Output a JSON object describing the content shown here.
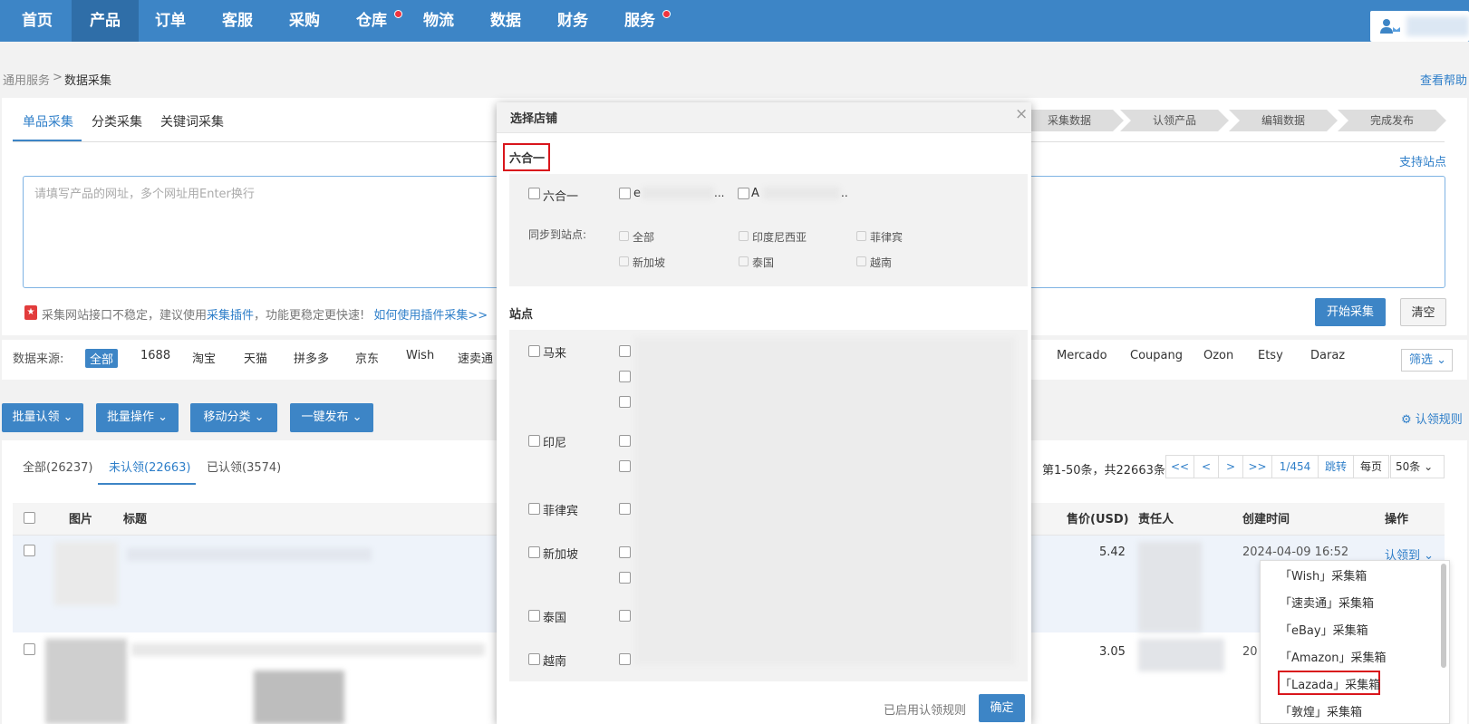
{
  "nav": {
    "items": [
      "首页",
      "产品",
      "订单",
      "客服",
      "采购",
      "仓库",
      "物流",
      "数据",
      "财务",
      "服务"
    ],
    "active_index": 1
  },
  "breadcrumb": {
    "parent": "通用服务",
    "sep": ">",
    "current": "数据采集"
  },
  "help_link": "查看帮助",
  "collect_tabs": [
    "单品采集",
    "分类采集",
    "关键词采集"
  ],
  "steps": [
    "采集数据",
    "认领产品",
    "编辑数据",
    "完成发布"
  ],
  "supported_sites": "支持站点",
  "url_input": {
    "placeholder": "请填写产品的网址，多个网址用Enter换行"
  },
  "notice": {
    "text1": "采集网站接口不稳定，建议使用",
    "plugin": "采集插件",
    "text2": "，功能更稳定更快速!",
    "howto": "如何使用插件采集>>"
  },
  "start_btn": "开始采集",
  "clear_btn": "清空",
  "sources": {
    "label": "数据来源:",
    "items": [
      "全部",
      "1688",
      "淘宝",
      "天猫",
      "拼多多",
      "京东",
      "Wish",
      "速卖通"
    ],
    "right_items": [
      "Mercado",
      "Coupang",
      "Ozon",
      "Etsy",
      "Daraz"
    ],
    "filter": "筛选"
  },
  "actions": [
    "批量认领",
    "批量操作",
    "移动分类",
    "一键发布"
  ],
  "claim_rules": "认领规则",
  "counts": [
    "全部(26237)",
    "未认领(22663)",
    "已认领(3574)"
  ],
  "pagination": {
    "summary": "第1-50条，共22663条",
    "first": "<<",
    "prev": "<",
    "next": ">",
    "last": ">>",
    "page": "1/454",
    "jump": "跳转",
    "per_page_label": "每页",
    "per_page": "50条"
  },
  "table": {
    "headers": {
      "image": "图片",
      "title": "标题",
      "price": "售价(USD)",
      "owner": "责任人",
      "created": "创建时间",
      "ops": "操作"
    },
    "rows": [
      {
        "price": "5.42",
        "created": "2024-04-09 16:52",
        "op": "认领到"
      },
      {
        "price": "3.05",
        "created": "20"
      }
    ]
  },
  "dropdown": [
    "「Wish」采集箱",
    "「速卖通」采集箱",
    "「eBay」采集箱",
    "「Amazon」采集箱",
    "「Lazada」采集箱",
    "「敦煌」采集箱"
  ],
  "dialog": {
    "title": "选择店铺",
    "close": "×",
    "section1": "六合一",
    "six_in_one": "六合一",
    "shop1_prefix": "e",
    "shop1_suffix": "...",
    "shop2_prefix": "A",
    "shop2_suffix": "..",
    "sync_label": "同步到站点:",
    "sync_sites": [
      "全部",
      "印度尼西亚",
      "菲律宾",
      "新加坡",
      "泰国",
      "越南"
    ],
    "section2": "站点",
    "sites": [
      "马来",
      "印尼",
      "菲律宾",
      "新加坡",
      "泰国",
      "越南"
    ],
    "footer_link": "已启用认领规则",
    "confirm": "确定"
  }
}
